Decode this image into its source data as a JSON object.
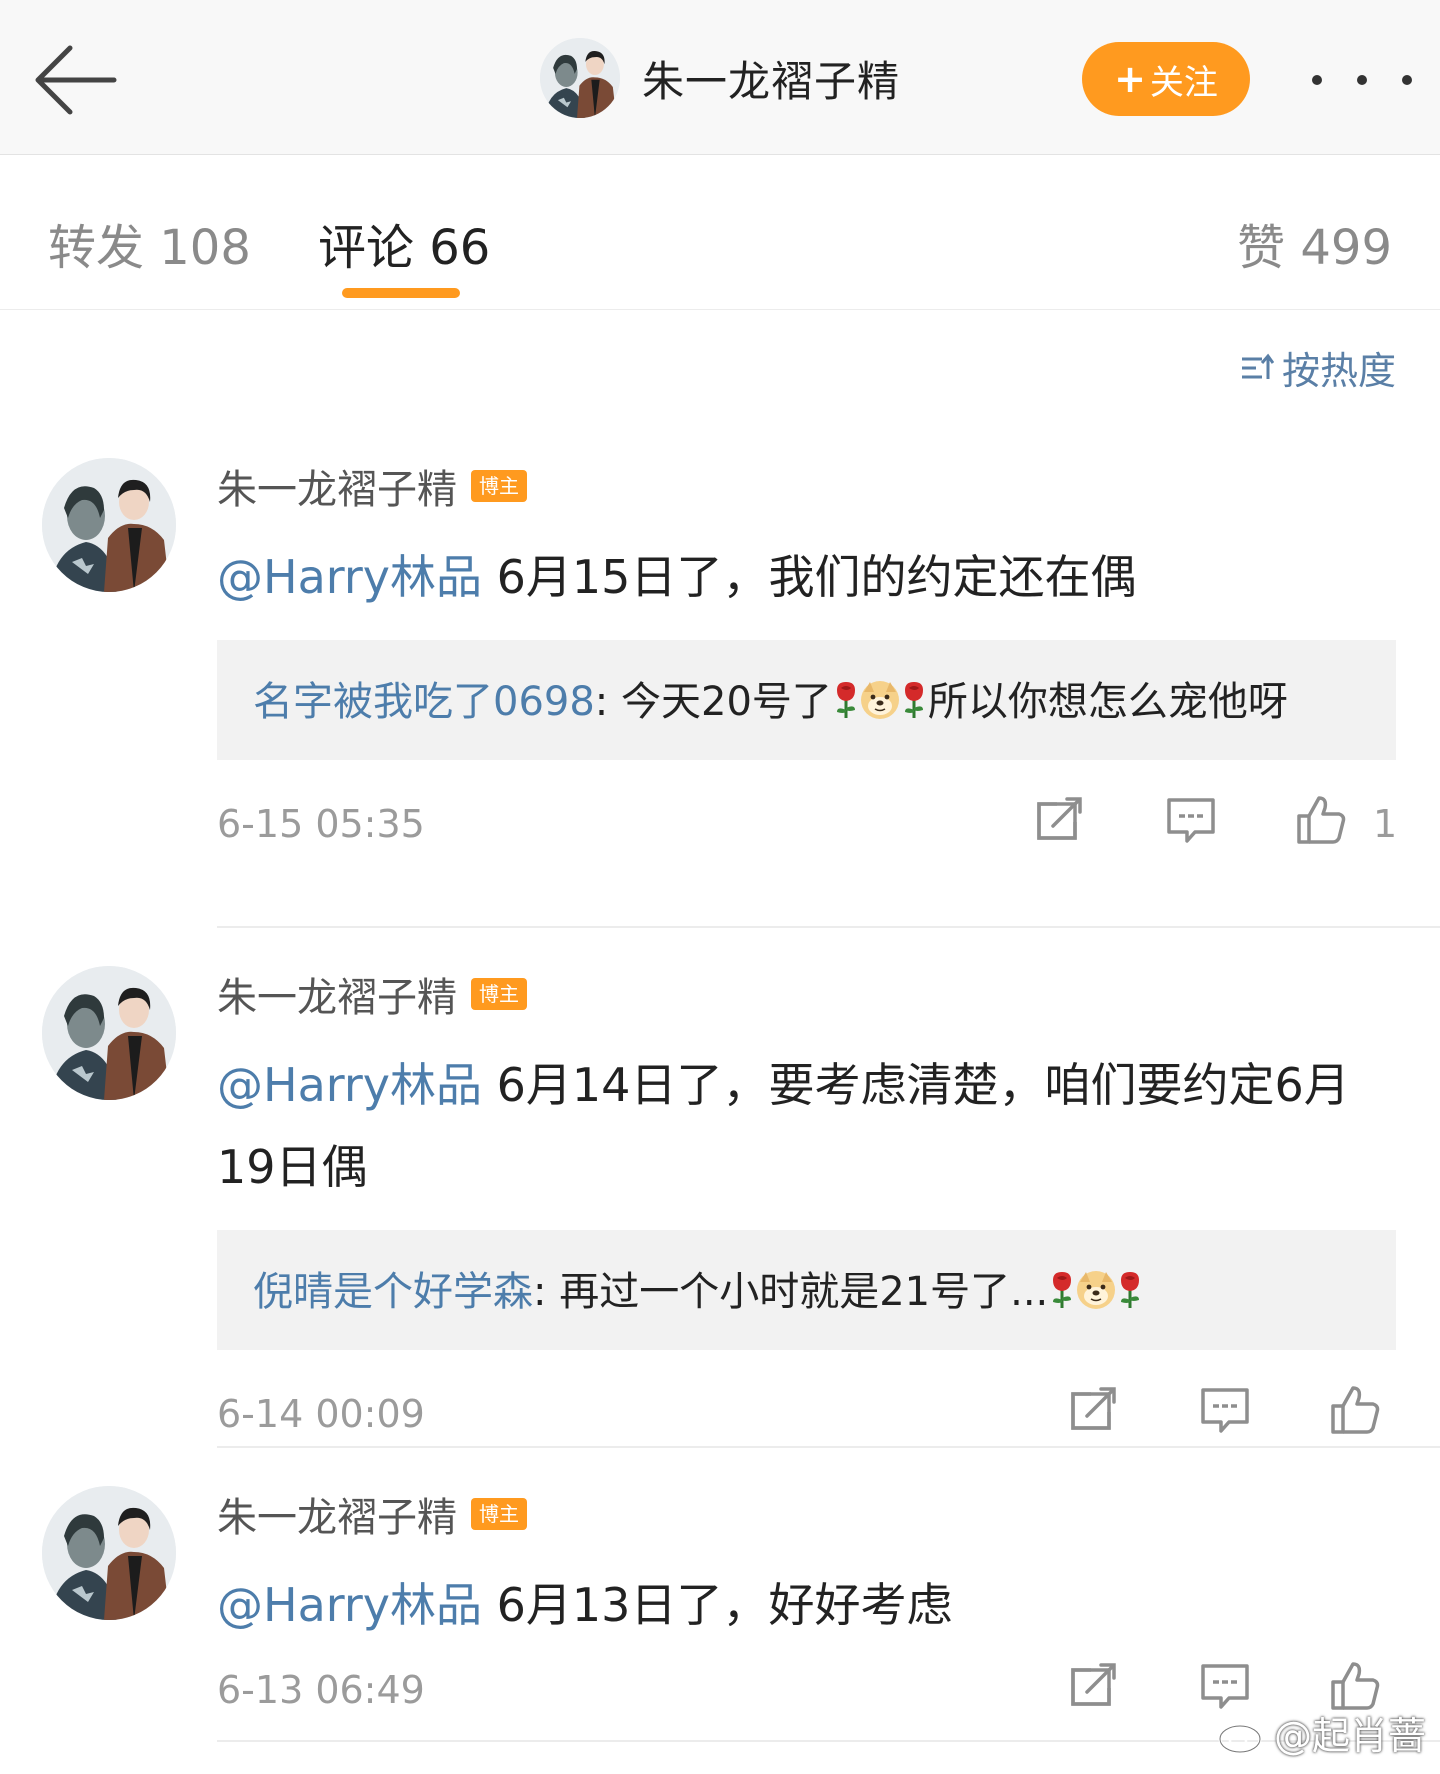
{
  "header": {
    "title": "朱一龙褶子精",
    "follow_label": "关注",
    "follow_plus": "+",
    "accent_color": "#ff9a1f"
  },
  "tabs": {
    "repost": "转发 108",
    "comment": "评论 66",
    "like": "赞 499"
  },
  "sort": {
    "label": "按热度",
    "icon": "sort-icon"
  },
  "comments": [
    {
      "author": "朱一龙褶子精",
      "badge": "博主",
      "mention": "@Harry林品",
      "text": " 6月15日了，我们的约定还在偶",
      "reply": {
        "name": "名字被我吃了0698",
        "sep": ": ",
        "text_before": "今天20号了",
        "text_after": "所以你想怎么宠他呀"
      },
      "time": "6-15 05:35",
      "like_count": "1"
    },
    {
      "author": "朱一龙褶子精",
      "badge": "博主",
      "mention": "@Harry林品",
      "text": " 6月14日了，要考虑清楚，咱们要约定6月19日偶",
      "reply": {
        "name": "倪晴是个好学森",
        "sep": ": ",
        "text_before": "再过一个小时就是21号了...",
        "text_after": ""
      },
      "time": "6-14 00:09",
      "like_count": ""
    },
    {
      "author": "朱一龙褶子精",
      "badge": "博主",
      "mention": "@Harry林品",
      "text": " 6月13日了，好好考虑",
      "time": "6-13 06:49",
      "like_count": ""
    }
  ],
  "watermark": {
    "text": "@起肖蔷",
    "icon": "weibo-logo-icon"
  },
  "colors": {
    "link": "#4d7dab",
    "muted": "#9b9b9b",
    "reply_bg": "#f2f2f2"
  }
}
